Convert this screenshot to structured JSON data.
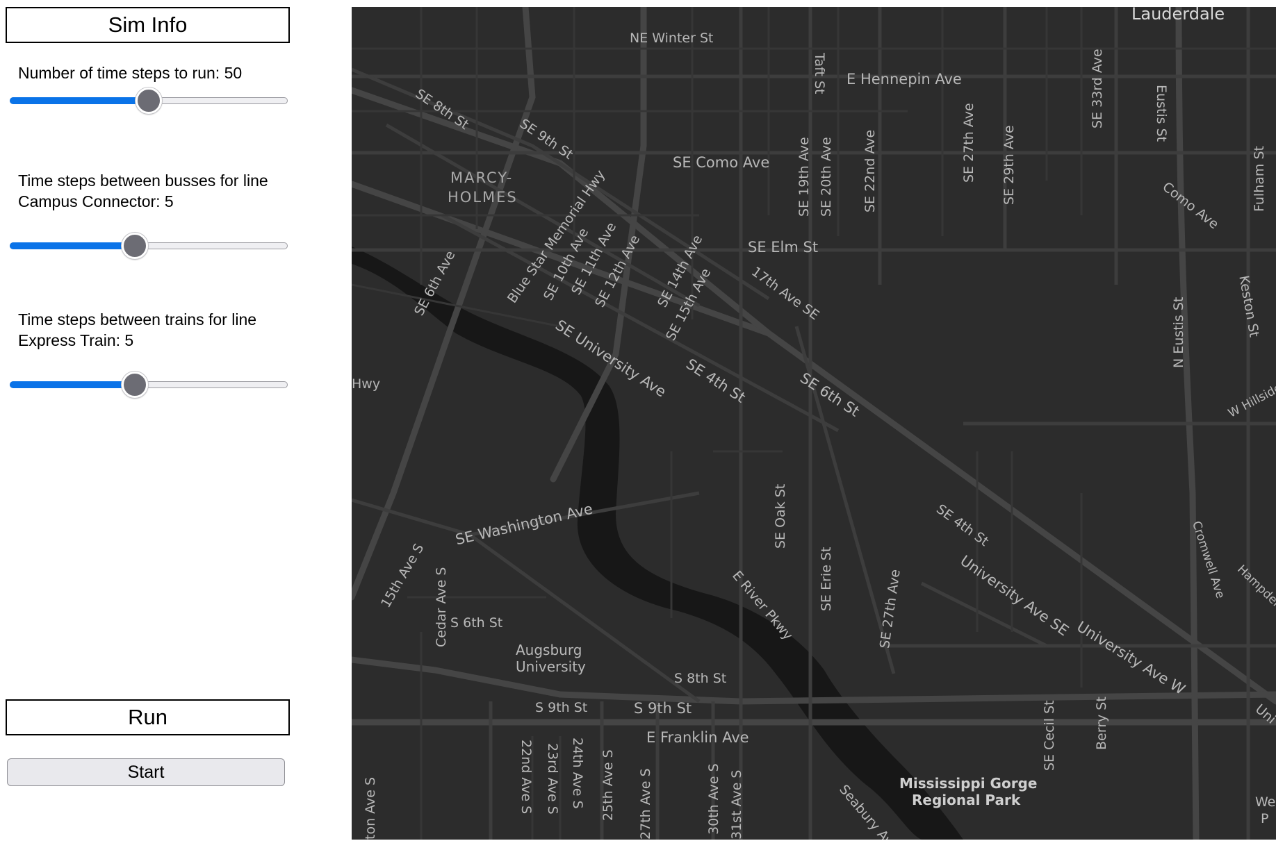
{
  "sidebar": {
    "header": "Sim Info",
    "steps_label": "Number of time steps to run:  50",
    "steps_value": 0.5,
    "bus_label_line1": "Time steps between busses for line",
    "bus_label_line2": "Campus Connector: 5",
    "bus_value": 0.45,
    "train_label_line1": "Time steps between trains for line",
    "train_label_line2": "Express Train: 5",
    "train_value": 0.45,
    "run_header": "Run",
    "start_button": "Start"
  },
  "map": {
    "labels": {
      "lauderdale": "Lauderdale",
      "ne_winter": "NE Winter St",
      "taft": "Taft St",
      "hennepin": "E Hennepin Ave",
      "se33rd": "SE 33rd Ave",
      "se8th": "SE 8th St",
      "se9th": "SE 9th St",
      "eustis": "Eustis St",
      "se27th_n": "SE 27th Ave",
      "se29th": "SE 29th Ave",
      "fulham": "Fulham St",
      "marcy": "MARCY-",
      "holmes": "HOLMES",
      "como": "SE Como Ave",
      "se19th": "SE 19th Ave",
      "se20th": "SE 20th Ave",
      "se22nd": "SE 22nd Ave",
      "como_ave": "Como Ave",
      "blue_star": "Blue Star Memorial Hwy",
      "se10th": "SE 10th Ave",
      "se11th": "SE 11th Ave",
      "se12th": "SE 12th Ave",
      "se_elm": "SE Elm St",
      "se6th_ave": "SE 6th Ave",
      "se14th": "SE 14th Ave",
      "se15th": "SE 15th Ave",
      "17th_se": "17th Ave SE",
      "keston": "Keston St",
      "n_eustis": "N Eustis St",
      "se_univ": "SE University Ave",
      "se4th": "SE 4th St",
      "se6th_st": "SE 6th St",
      "w_hillside": "W Hillside",
      "hwy": "Hwy",
      "se_wash": "SE Washington Ave",
      "se_oak": "SE Oak St",
      "se4th_b": "SE 4th St",
      "cromwell": "Cromwell Ave",
      "hampden": "Hampden",
      "ave15s": "15th Ave S",
      "cedar": "Cedar Ave S",
      "se_erie": "SE Erie St",
      "se27th_s": "SE 27th Ave",
      "univ_se": "University Ave SE",
      "e_river": "E River Pkwy",
      "s6th": "S 6th St",
      "augsburg1": "Augsburg",
      "augsburg2": "University",
      "univ_w": "University Ave W",
      "s8th": "S 8th St",
      "s9th_a": "S 9th St",
      "s9th_b": "S 9th St",
      "se_cecil": "SE Cecil St",
      "berry": "Berry St",
      "uni": "Uni",
      "franklin": "E Franklin Ave",
      "22nd": "22nd Ave S",
      "23rd": "23rd Ave S",
      "24th": "24th Ave S",
      "25th": "25th Ave S",
      "27th": "27th Ave S",
      "30th": "30th Ave S",
      "31st": "31st Ave S",
      "ton": "ton Ave S",
      "seabury": "Seabury Ave",
      "gorge1": "Mississippi Gorge",
      "gorge2": "Regional Park",
      "we": "We",
      "p": "P"
    }
  }
}
